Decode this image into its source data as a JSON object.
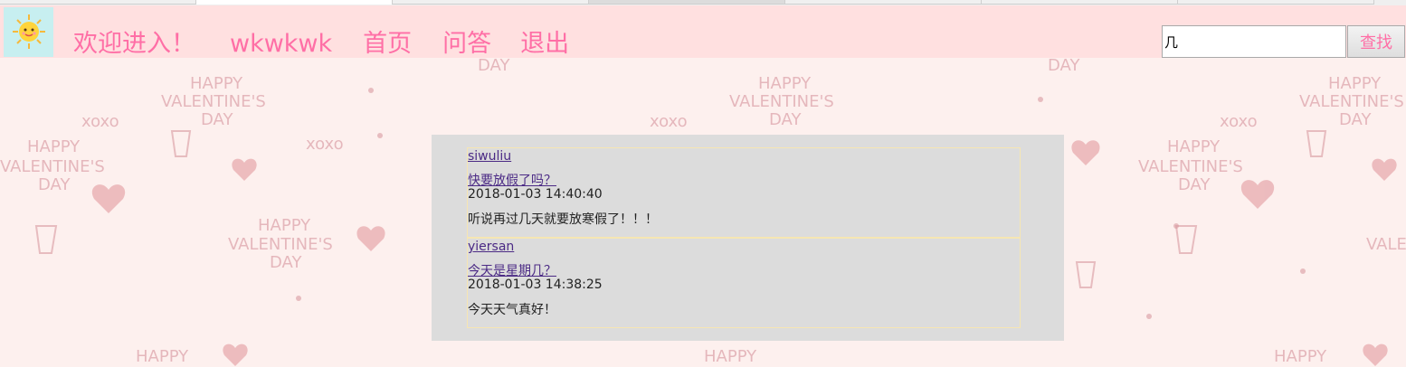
{
  "header": {
    "welcome_text": "欢迎进入！",
    "username": "wkwkwk",
    "nav_home": "首页",
    "nav_qa": "问答",
    "nav_logout": "退出"
  },
  "search": {
    "value": "几",
    "button_label": "查找"
  },
  "posts": [
    {
      "author": "siwuliu",
      "title": "快要放假了吗？",
      "time": "2018-01-03 14:40:40",
      "content": "听说再过几天就要放寒假了！！！"
    },
    {
      "author": "yiersan",
      "title": "今天是星期几？",
      "time": "2018-01-03 14:38:25",
      "content": "今天天气真好！"
    }
  ],
  "colors": {
    "header_bg": "#ffe0e0",
    "nav_text": "#ff6fa6",
    "panel_bg": "#dcdcdc",
    "link": "#4b2a85",
    "page_bg": "#fdf0ee"
  }
}
